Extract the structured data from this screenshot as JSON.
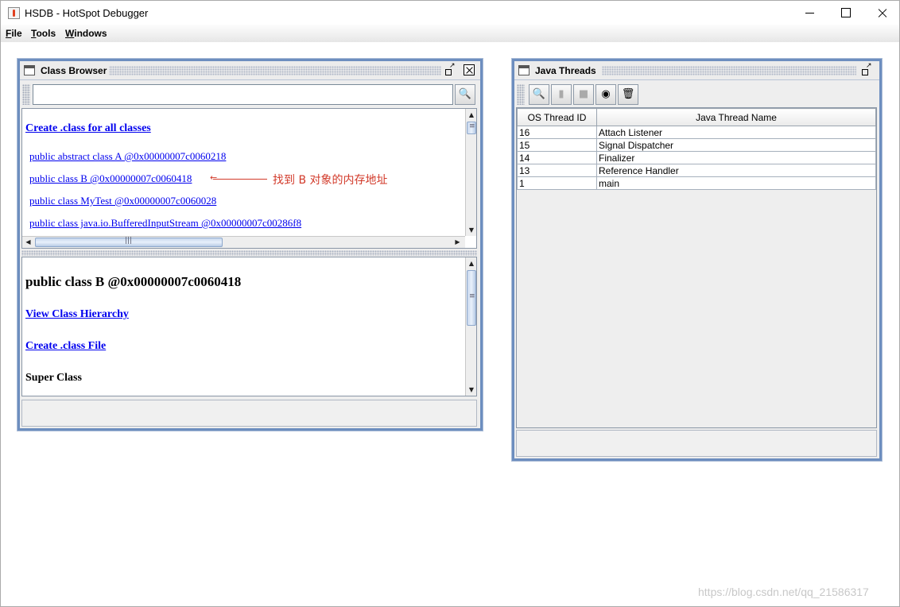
{
  "window": {
    "title": "HSDB - HotSpot Debugger"
  },
  "menu": {
    "items": [
      "File",
      "Tools",
      "Windows"
    ]
  },
  "class_browser": {
    "title": "Class Browser",
    "search_value": "",
    "create_all_link": "Create .class for all classes",
    "classes": [
      "public abstract class A @0x00000007c0060218",
      "public class B @0x00000007c0060418",
      "public class MyTest @0x00000007c0060028",
      "public class java.io.BufferedInputStream @0x00000007c00286f8"
    ],
    "annotation": "找到 B 对象的内存地址",
    "detail": {
      "heading": "public class B @0x00000007c0060418",
      "hierarchy_link": "View Class Hierarchy",
      "create_file_link": "Create .class File",
      "super_class_label": "Super Class"
    }
  },
  "java_threads": {
    "title": "Java Threads",
    "toolbar": [
      "inspect-thread",
      "stack-memory",
      "show-java-stack-trace",
      "thread-info",
      "find-crashes"
    ],
    "columns": [
      "OS Thread ID",
      "Java Thread Name"
    ],
    "rows": [
      [
        "16",
        "Attach Listener"
      ],
      [
        "15",
        "Signal Dispatcher"
      ],
      [
        "14",
        "Finalizer"
      ],
      [
        "13",
        "Reference Handler"
      ],
      [
        "1",
        "main"
      ]
    ]
  },
  "watermark": "https://blog.csdn.net/qq_21586317",
  "colors": {
    "frame_border": "#6d8ebf",
    "link": "#0000ee",
    "annotation": "#d23a2a"
  }
}
